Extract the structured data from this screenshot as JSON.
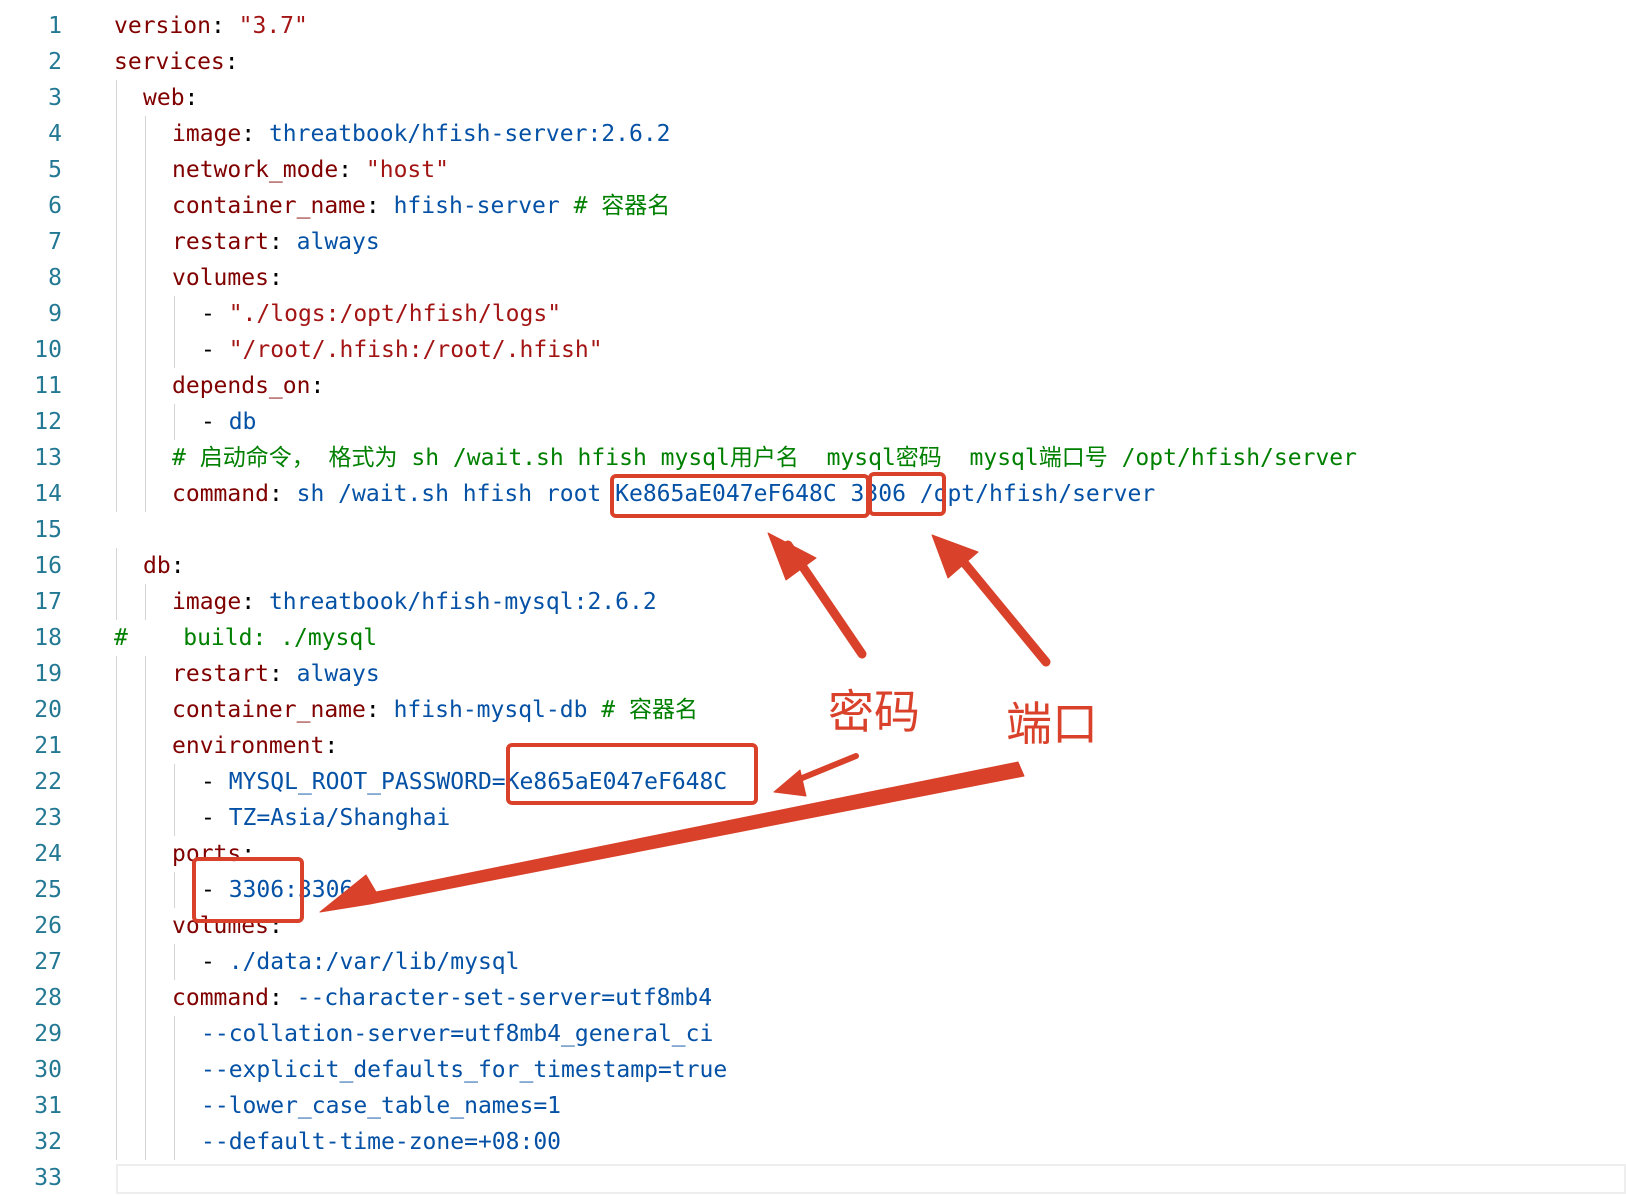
{
  "editor": {
    "language": "yaml",
    "lines": [
      {
        "n": "1",
        "indent": 0,
        "segs": [
          {
            "t": "version",
            "c": "k"
          },
          {
            "t": ": ",
            "c": "p"
          },
          {
            "t": "\"3.7\"",
            "c": "s"
          }
        ]
      },
      {
        "n": "2",
        "indent": 0,
        "segs": [
          {
            "t": "services",
            "c": "k"
          },
          {
            "t": ":",
            "c": "p"
          }
        ]
      },
      {
        "n": "3",
        "indent": 1,
        "segs": [
          {
            "t": "web",
            "c": "k"
          },
          {
            "t": ":",
            "c": "p"
          }
        ]
      },
      {
        "n": "4",
        "indent": 2,
        "segs": [
          {
            "t": "image",
            "c": "k"
          },
          {
            "t": ": ",
            "c": "p"
          },
          {
            "t": "threatbook/hfish-server:2.6.2",
            "c": "v"
          }
        ]
      },
      {
        "n": "5",
        "indent": 2,
        "segs": [
          {
            "t": "network_mode",
            "c": "k"
          },
          {
            "t": ": ",
            "c": "p"
          },
          {
            "t": "\"host\"",
            "c": "s"
          }
        ]
      },
      {
        "n": "6",
        "indent": 2,
        "segs": [
          {
            "t": "container_name",
            "c": "k"
          },
          {
            "t": ": ",
            "c": "p"
          },
          {
            "t": "hfish-server ",
            "c": "v"
          },
          {
            "t": "# 容器名",
            "c": "c"
          }
        ]
      },
      {
        "n": "7",
        "indent": 2,
        "segs": [
          {
            "t": "restart",
            "c": "k"
          },
          {
            "t": ": ",
            "c": "p"
          },
          {
            "t": "always",
            "c": "v"
          }
        ]
      },
      {
        "n": "8",
        "indent": 2,
        "segs": [
          {
            "t": "volumes",
            "c": "k"
          },
          {
            "t": ":",
            "c": "p"
          }
        ]
      },
      {
        "n": "9",
        "indent": 3,
        "segs": [
          {
            "t": "- ",
            "c": "p"
          },
          {
            "t": "\"./logs:/opt/hfish/logs\"",
            "c": "s"
          }
        ]
      },
      {
        "n": "10",
        "indent": 3,
        "segs": [
          {
            "t": "- ",
            "c": "p"
          },
          {
            "t": "\"/root/.hfish:/root/.hfish\"",
            "c": "s"
          }
        ]
      },
      {
        "n": "11",
        "indent": 2,
        "segs": [
          {
            "t": "depends_on",
            "c": "k"
          },
          {
            "t": ":",
            "c": "p"
          }
        ]
      },
      {
        "n": "12",
        "indent": 3,
        "segs": [
          {
            "t": "- ",
            "c": "p"
          },
          {
            "t": "db",
            "c": "v"
          }
        ]
      },
      {
        "n": "13",
        "indent": 2,
        "segs": [
          {
            "t": "# 启动命令， 格式为 sh /wait.sh hfish mysql用户名  mysql密码  mysql端口号 /opt/hfish/server",
            "c": "c"
          }
        ]
      },
      {
        "n": "14",
        "indent": 2,
        "segs": [
          {
            "t": "command",
            "c": "k"
          },
          {
            "t": ": ",
            "c": "p"
          },
          {
            "t": "sh /wait.sh hfish root Ke865aE047eF648C 3306 /opt/hfish/server",
            "c": "v"
          }
        ]
      },
      {
        "n": "15",
        "indent": 0,
        "segs": []
      },
      {
        "n": "16",
        "indent": 1,
        "segs": [
          {
            "t": "db",
            "c": "k"
          },
          {
            "t": ":",
            "c": "p"
          }
        ]
      },
      {
        "n": "17",
        "indent": 2,
        "segs": [
          {
            "t": "image",
            "c": "k"
          },
          {
            "t": ": ",
            "c": "p"
          },
          {
            "t": "threatbook/hfish-mysql:2.6.2",
            "c": "v"
          }
        ]
      },
      {
        "n": "18",
        "indent": 0,
        "segs": [
          {
            "t": "#    build: ./mysql",
            "c": "c"
          }
        ]
      },
      {
        "n": "19",
        "indent": 2,
        "segs": [
          {
            "t": "restart",
            "c": "k"
          },
          {
            "t": ": ",
            "c": "p"
          },
          {
            "t": "always",
            "c": "v"
          }
        ]
      },
      {
        "n": "20",
        "indent": 2,
        "segs": [
          {
            "t": "container_name",
            "c": "k"
          },
          {
            "t": ": ",
            "c": "p"
          },
          {
            "t": "hfish-mysql-db ",
            "c": "v"
          },
          {
            "t": "# 容器名",
            "c": "c"
          }
        ]
      },
      {
        "n": "21",
        "indent": 2,
        "segs": [
          {
            "t": "environment",
            "c": "k"
          },
          {
            "t": ":",
            "c": "p"
          }
        ]
      },
      {
        "n": "22",
        "indent": 3,
        "segs": [
          {
            "t": "- ",
            "c": "p"
          },
          {
            "t": "MYSQL_ROOT_PASSWORD=Ke865aE047eF648C",
            "c": "v"
          }
        ]
      },
      {
        "n": "23",
        "indent": 3,
        "segs": [
          {
            "t": "- ",
            "c": "p"
          },
          {
            "t": "TZ=Asia/Shanghai",
            "c": "v"
          }
        ]
      },
      {
        "n": "24",
        "indent": 2,
        "segs": [
          {
            "t": "ports",
            "c": "k"
          },
          {
            "t": ":",
            "c": "p"
          }
        ]
      },
      {
        "n": "25",
        "indent": 3,
        "segs": [
          {
            "t": "- ",
            "c": "p"
          },
          {
            "t": "3306:3306",
            "c": "v"
          }
        ]
      },
      {
        "n": "26",
        "indent": 2,
        "segs": [
          {
            "t": "volumes",
            "c": "k"
          },
          {
            "t": ":",
            "c": "p"
          }
        ]
      },
      {
        "n": "27",
        "indent": 3,
        "segs": [
          {
            "t": "- ",
            "c": "p"
          },
          {
            "t": "./data:/var/lib/mysql",
            "c": "v"
          }
        ]
      },
      {
        "n": "28",
        "indent": 2,
        "segs": [
          {
            "t": "command",
            "c": "k"
          },
          {
            "t": ": ",
            "c": "p"
          },
          {
            "t": "--character-set-server=utf8mb4",
            "c": "v"
          }
        ]
      },
      {
        "n": "29",
        "indent": 3,
        "segs": [
          {
            "t": "--collation-server=utf8mb4_general_ci",
            "c": "v"
          }
        ]
      },
      {
        "n": "30",
        "indent": 3,
        "segs": [
          {
            "t": "--explicit_defaults_for_timestamp=true",
            "c": "v"
          }
        ]
      },
      {
        "n": "31",
        "indent": 3,
        "segs": [
          {
            "t": "--lower_case_table_names=1",
            "c": "v"
          }
        ]
      },
      {
        "n": "32",
        "indent": 3,
        "segs": [
          {
            "t": "--default-time-zone=+08:00",
            "c": "v"
          }
        ]
      },
      {
        "n": "33",
        "indent": 0,
        "segs": []
      }
    ]
  },
  "annotations": {
    "password_label": "密码",
    "port_label": "端口"
  },
  "colors": {
    "annotation": "#d9412a",
    "key": "#800000",
    "value": "#0451a5",
    "string": "#a31515",
    "comment": "#008000",
    "line_number": "#237893"
  }
}
